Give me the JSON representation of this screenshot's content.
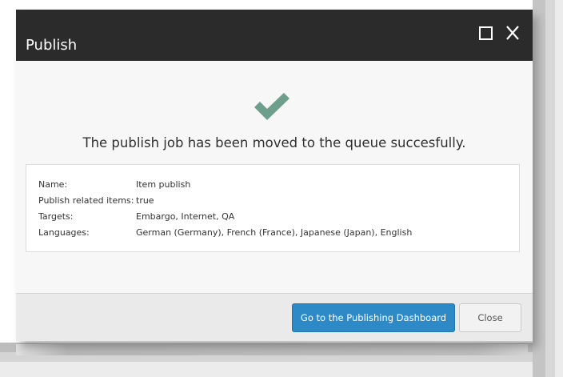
{
  "dialog": {
    "title": "Publish",
    "maximize_icon": "maximize-icon",
    "close_icon": "close-icon"
  },
  "status": {
    "icon": "checkmark-icon",
    "icon_color": "#6e9e8c",
    "message": "The publish job has been moved to the queue succesfully."
  },
  "details": {
    "rows": [
      {
        "label": "Name:",
        "value": "Item publish"
      },
      {
        "label": "Publish related items:",
        "value": "true"
      },
      {
        "label": "Targets:",
        "value": "Embargo, Internet, QA"
      },
      {
        "label": "Languages:",
        "value": "German (Germany), French (France), Japanese (Japan), English"
      }
    ]
  },
  "footer": {
    "primary_label": "Go to the Publishing Dashboard",
    "secondary_label": "Close"
  },
  "colors": {
    "titlebar": "#2b2b2b",
    "primary_button": "#2e8ac6"
  }
}
